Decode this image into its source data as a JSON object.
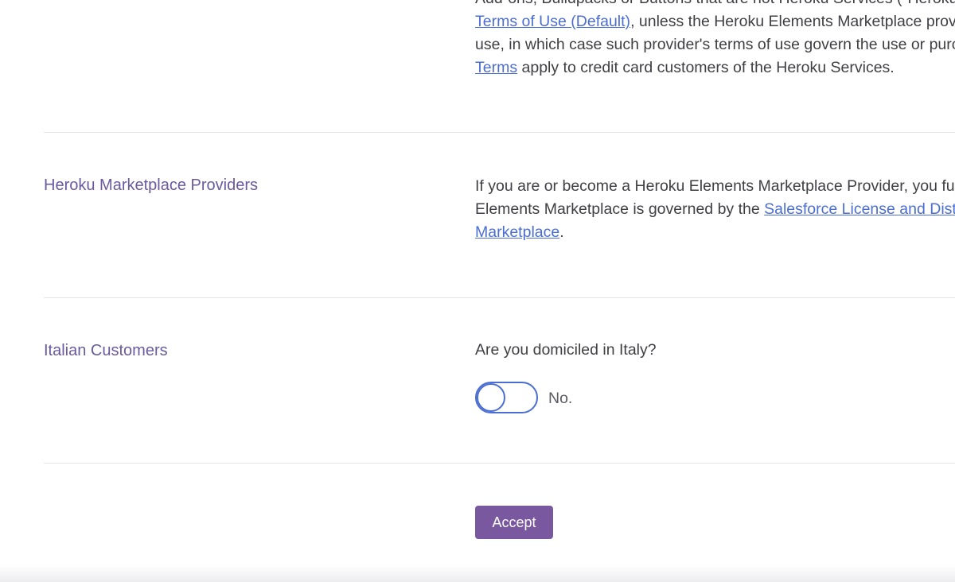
{
  "terms_section": {
    "line0": "Add-ons, Buildpacks or Buttons that are not Heroku Services (\"Heroku Elements\")",
    "line1_link": "Terms of Use (Default)",
    "line1_rest": ", unless the Heroku Elements Marketplace provider specifies its own terms of",
    "line2": "use, in which case such provider's terms of use govern the use or purchase. The",
    "line3_link": "Terms",
    "line3_rest": " apply to credit card customers of the Heroku Services."
  },
  "marketplace_section": {
    "label": "Heroku Marketplace Providers",
    "line1": "If you are or become a Heroku Elements Marketplace Provider, you further agree that your use of the",
    "line2_prefix": "Elements Marketplace is governed by the ",
    "line2_link": "Salesforce License and Distribution Agreement for the Heroku",
    "line3_link": "Marketplace",
    "line3_rest": "."
  },
  "italian_section": {
    "label": "Italian Customers",
    "question": "Are you domiciled in Italy?",
    "toggle_state": "off",
    "toggle_text": "No."
  },
  "actions": {
    "accept_label": "Accept"
  },
  "colors": {
    "accent_purple": "#79589f",
    "label_purple": "#6a5a9e",
    "link_blue": "#4b6ed2",
    "body_text": "#3f3f44"
  }
}
